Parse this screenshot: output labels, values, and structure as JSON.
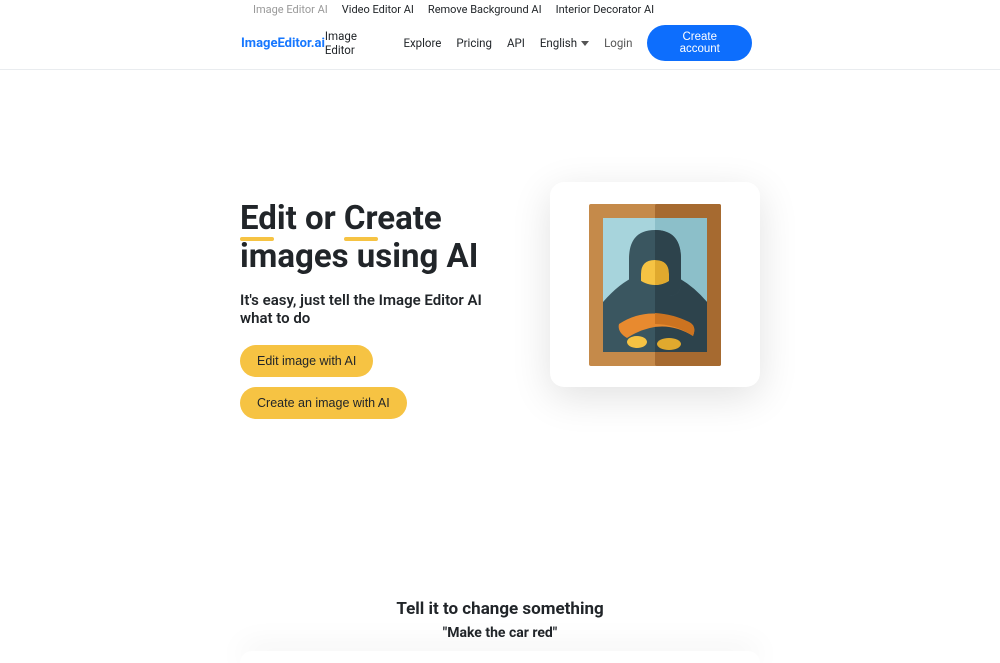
{
  "topNav": {
    "items": [
      {
        "label": "Image Editor AI",
        "active": true
      },
      {
        "label": "Video Editor AI",
        "active": false
      },
      {
        "label": "Remove Background AI",
        "active": false
      },
      {
        "label": "Interior Decorator AI",
        "active": false
      }
    ]
  },
  "header": {
    "logo": "ImageEditor.ai",
    "nav": {
      "imageEditor": "Image Editor",
      "explore": "Explore",
      "pricing": "Pricing",
      "api": "API",
      "language": "English",
      "login": "Login",
      "createAccount": "Create account"
    }
  },
  "hero": {
    "titleWord1": "Edit",
    "titleMid": " or ",
    "titleWord2": "Create",
    "titleLine2": "images using AI",
    "subtitle": "It's easy, just tell the Image Editor AI what to do",
    "ctaEdit": "Edit image with AI",
    "ctaCreate": "Create an image with AI"
  },
  "section2": {
    "heading": "Tell it to change something",
    "quote": "\"Make the car red\""
  }
}
